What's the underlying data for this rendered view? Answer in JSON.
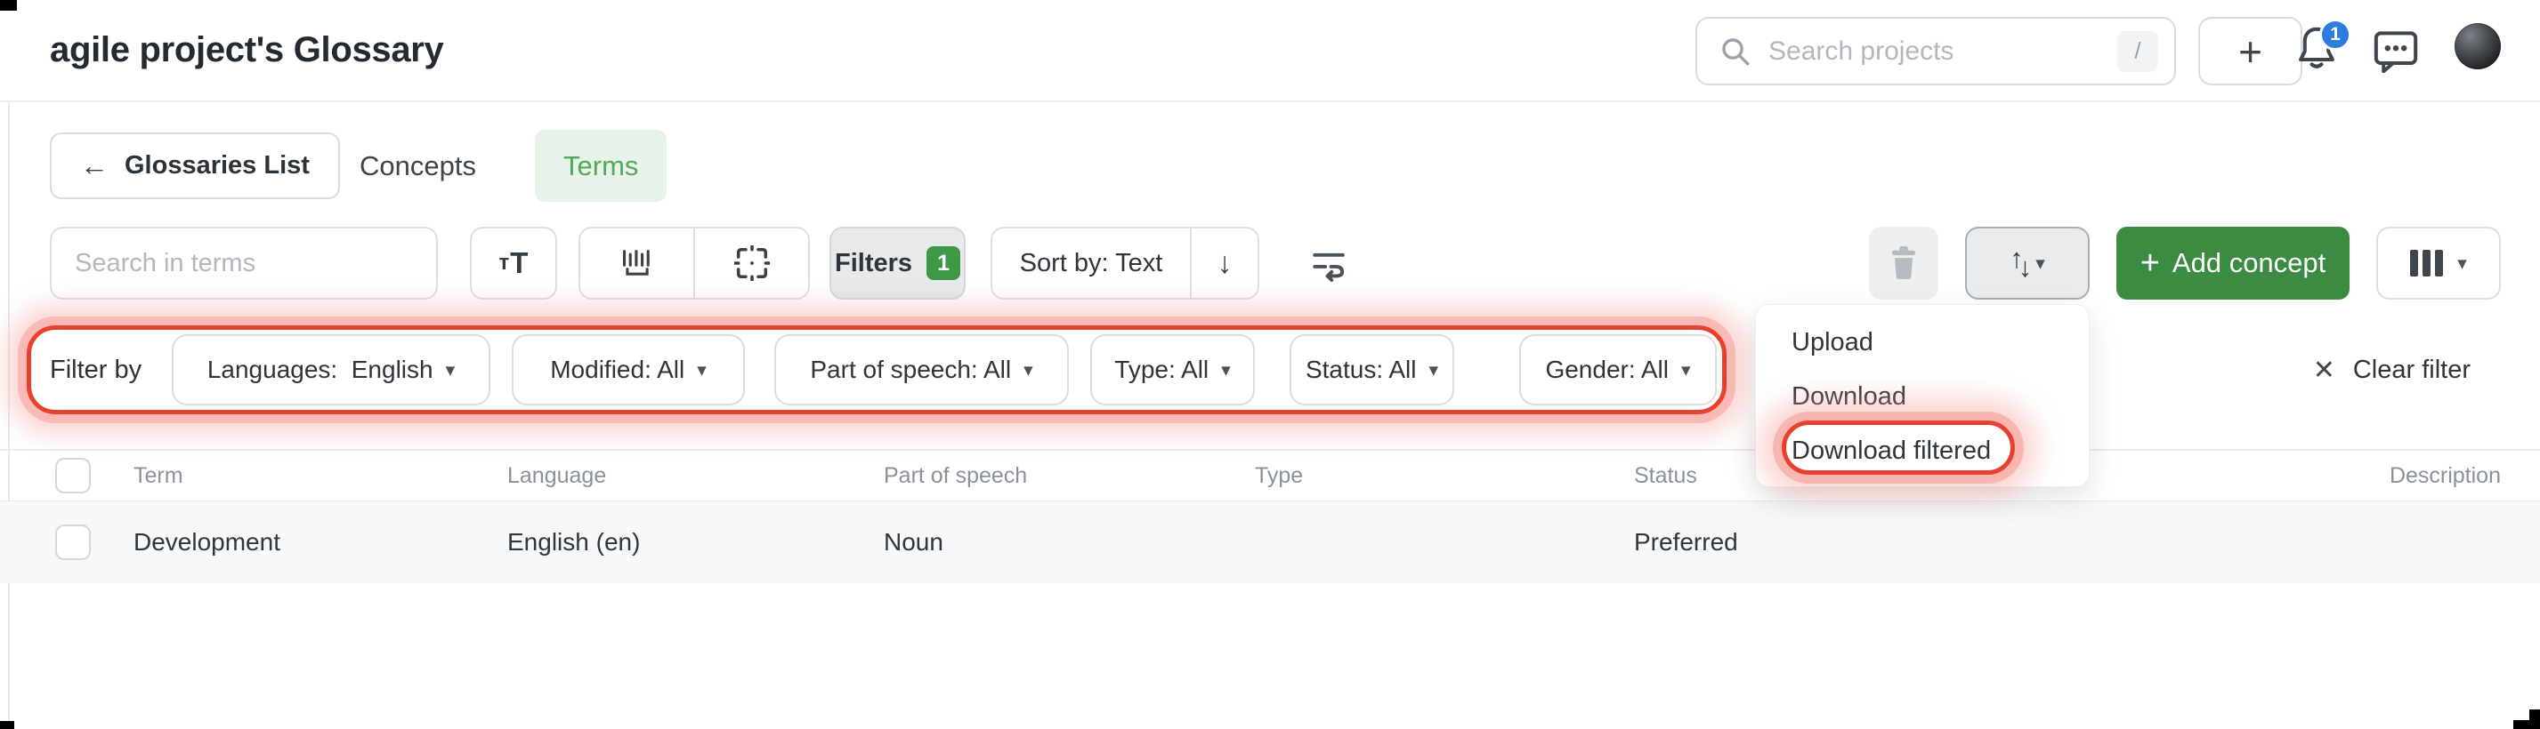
{
  "header": {
    "title": "agile project's Glossary",
    "search_placeholder": "Search projects",
    "slash_hint": "/",
    "notifications_badge": "1"
  },
  "nav": {
    "back": "Glossaries List",
    "tab_concepts": "Concepts",
    "tab_terms": "Terms"
  },
  "toolbar": {
    "terms_search_placeholder": "Search in terms",
    "filters": "Filters",
    "filters_badge": "1",
    "sort": "Sort by: Text",
    "add_concept": "Add concept"
  },
  "filter_bar": {
    "label": "Filter by",
    "languages": "Languages:  English",
    "modified": "Modified: All",
    "part_of_speech": "Part of speech: All",
    "type": "Type: All",
    "status": "Status: All",
    "gender": "Gender: All",
    "clear": "Clear filter"
  },
  "menu": {
    "upload": "Upload",
    "download": "Download",
    "download_filtered": "Download filtered"
  },
  "table": {
    "columns": [
      "Term",
      "Language",
      "Part of speech",
      "Type",
      "Status",
      "Description"
    ],
    "rows": [
      {
        "term": "Development",
        "language": "English (en)",
        "part_of_speech": "Noun",
        "type": "",
        "status": "Preferred",
        "description": ""
      }
    ]
  },
  "icons": {
    "back_arrow": "←",
    "chevron_down": "▾",
    "sort_arrow": "↓",
    "arrow_up": "↑",
    "arrow_down": "↓",
    "plus": "+",
    "close": "✕",
    "match_case_small": "т",
    "match_case_big": "T"
  },
  "colors": {
    "accent_green": "#3c8b42",
    "tab_green": "#54a85b",
    "badge_green": "#3f9845",
    "annotation_red": "#e8402e",
    "badge_blue": "#2b7de0",
    "row_bg": "#f7f8f9"
  }
}
